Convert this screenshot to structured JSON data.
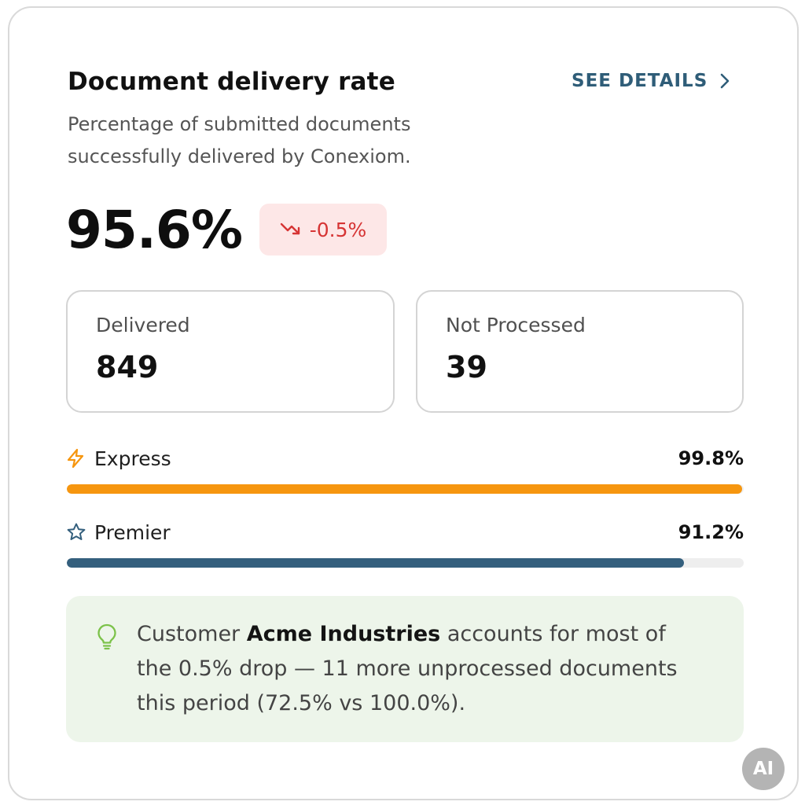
{
  "card": {
    "title": "Document delivery rate",
    "see_details_label": "SEE DETAILS",
    "subtitle": "Percentage of submitted documents successfully delivered by Conexiom."
  },
  "kpi": {
    "value": "95.6%",
    "delta": "-0.5%",
    "delta_icon": "trend-down-icon"
  },
  "stats": {
    "delivered": {
      "label": "Delivered",
      "value": "849"
    },
    "not_processed": {
      "label": "Not Processed",
      "value": "39"
    }
  },
  "tiers": {
    "express": {
      "name": "Express",
      "percent_label": "99.8%",
      "percent": 99.8,
      "icon": "lightning-icon",
      "color": "#f6960f"
    },
    "premier": {
      "name": "Premier",
      "percent_label": "91.2%",
      "percent": 91.2,
      "icon": "star-icon",
      "color": "#345f7d"
    }
  },
  "insight": {
    "icon": "lightbulb-icon",
    "prefix": "Customer ",
    "customer": "Acme Industries",
    "suffix": " accounts for most of the 0.5% drop — 11 more unprocessed documents this period (72.5% vs 100.0%)."
  },
  "ai_badge": {
    "label": "AI"
  },
  "colors": {
    "accent": "#2f5d78",
    "negative": "#d63434",
    "negative_bg": "#fde7e7",
    "insight_bg": "#edf5ea",
    "insight_icon": "#7cc24a"
  }
}
